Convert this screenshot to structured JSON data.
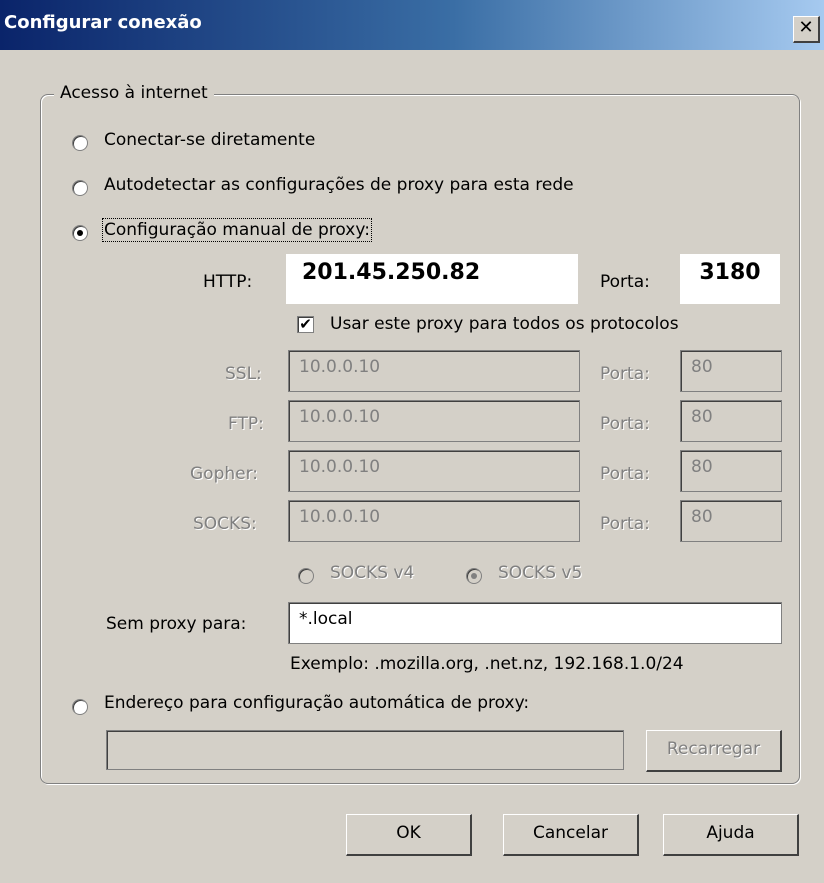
{
  "window": {
    "title": "Configurar conexão",
    "close_glyph": "✕"
  },
  "group": {
    "label": "Acesso à internet"
  },
  "options": {
    "direct": {
      "label": "Conectar-se diretamente",
      "selected": false
    },
    "auto": {
      "label": "Autodetectar as configurações de proxy para esta rede",
      "selected": false
    },
    "manual": {
      "label": "Configuração manual de proxy:",
      "selected": true
    },
    "pac": {
      "label": "Endereço para configuração automática de proxy:",
      "selected": false
    }
  },
  "proxies": {
    "http": {
      "label": "HTTP:",
      "host": "201.45.250.82",
      "port_label": "Porta:",
      "port": "3180"
    },
    "use_all": {
      "label": "Usar este proxy para todos os protocolos",
      "checked": true
    },
    "ssl": {
      "label": "SSL:",
      "host": "10.0.0.10",
      "port_label": "Porta:",
      "port": "80"
    },
    "ftp": {
      "label": "FTP:",
      "host": "10.0.0.10",
      "port_label": "Porta:",
      "port": "80"
    },
    "gopher": {
      "label": "Gopher:",
      "host": "10.0.0.10",
      "port_label": "Porta:",
      "port": "80"
    },
    "socks": {
      "label": "SOCKS:",
      "host": "10.0.0.10",
      "port_label": "Porta:",
      "port": "80"
    },
    "socks_v4": {
      "label": "SOCKS v4",
      "selected": false
    },
    "socks_v5": {
      "label": "SOCKS v5",
      "selected": true
    }
  },
  "no_proxy": {
    "label": "Sem proxy para:",
    "value": "*.local",
    "example": "Exemplo: .mozilla.org, .net.nz, 192.168.1.0/24"
  },
  "pac": {
    "url": "",
    "reload_label": "Recarregar"
  },
  "buttons": {
    "ok": "OK",
    "cancel": "Cancelar",
    "help": "Ajuda"
  }
}
